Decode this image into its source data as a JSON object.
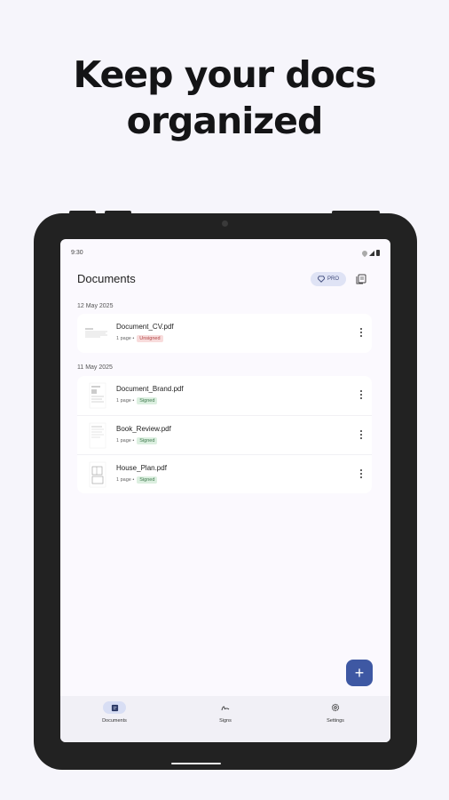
{
  "headline": {
    "line1": "Keep your docs",
    "line2": "organized"
  },
  "status": {
    "time": "9:30"
  },
  "app": {
    "title": "Documents",
    "pro_label": "PRO"
  },
  "groups": [
    {
      "date": "12 May 2025",
      "documents": [
        {
          "name": "Document_CV.pdf",
          "pages": "1 page •",
          "status": "Unsigned"
        }
      ]
    },
    {
      "date": "11 May 2025",
      "documents": [
        {
          "name": "Document_Brand.pdf",
          "pages": "1 page •",
          "status": "Signed"
        },
        {
          "name": "Book_Review.pdf",
          "pages": "1 page •",
          "status": "Signed"
        },
        {
          "name": "House_Plan.pdf",
          "pages": "1 page •",
          "status": "Signed"
        }
      ]
    }
  ],
  "fab": {
    "label": "+"
  },
  "nav": [
    {
      "label": "Documents",
      "icon": "document-icon",
      "active": true
    },
    {
      "label": "Signs",
      "icon": "signature-icon",
      "active": false
    },
    {
      "label": "Settings",
      "icon": "gear-icon",
      "active": false
    }
  ],
  "colors": {
    "accent": "#3e58a3",
    "unsigned": "#f8dcdc",
    "signed": "#dcefe0"
  }
}
